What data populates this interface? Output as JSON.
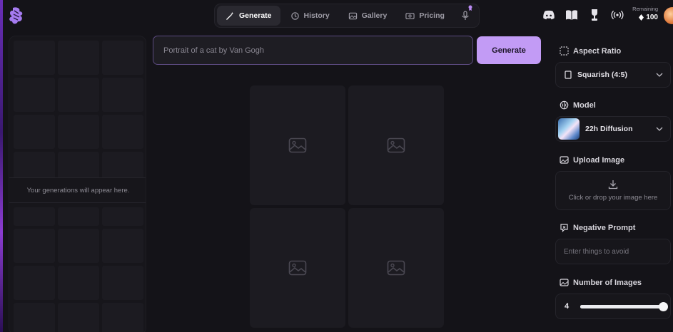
{
  "nav": {
    "tabs": [
      {
        "label": "Generate",
        "icon": "magic-wand-icon",
        "active": true
      },
      {
        "label": "History",
        "icon": "history-icon",
        "active": false
      },
      {
        "label": "Gallery",
        "icon": "gallery-icon",
        "active": false
      },
      {
        "label": "Pricing",
        "icon": "pricing-icon",
        "active": false
      }
    ]
  },
  "header_icons": [
    "discord-icon",
    "docs-book-icon",
    "trophy-icon",
    "broadcast-icon"
  ],
  "credits": {
    "label": "Remaining",
    "value": "100",
    "icon": "gem-icon"
  },
  "left_panel": {
    "empty_message": "Your generations will appear here."
  },
  "prompt": {
    "placeholder": "Portrait of a cat by Van Gogh",
    "value": ""
  },
  "generate_button": {
    "label": "Generate"
  },
  "settings": {
    "aspect_ratio": {
      "heading": "Aspect Ratio",
      "value": "Squarish (4:5)"
    },
    "model": {
      "heading": "Model",
      "value": "22h Diffusion"
    },
    "upload": {
      "heading": "Upload Image",
      "hint": "Click or drop your image here"
    },
    "negative_prompt": {
      "heading": "Negative Prompt",
      "placeholder": "Enter things to avoid"
    },
    "num_images": {
      "heading": "Number of Images",
      "value": "4",
      "fraction": 1.0
    }
  },
  "colors": {
    "accent": "#c29bf5",
    "background": "#141318",
    "panel": "#17161b",
    "tile": "#1c1b21"
  }
}
